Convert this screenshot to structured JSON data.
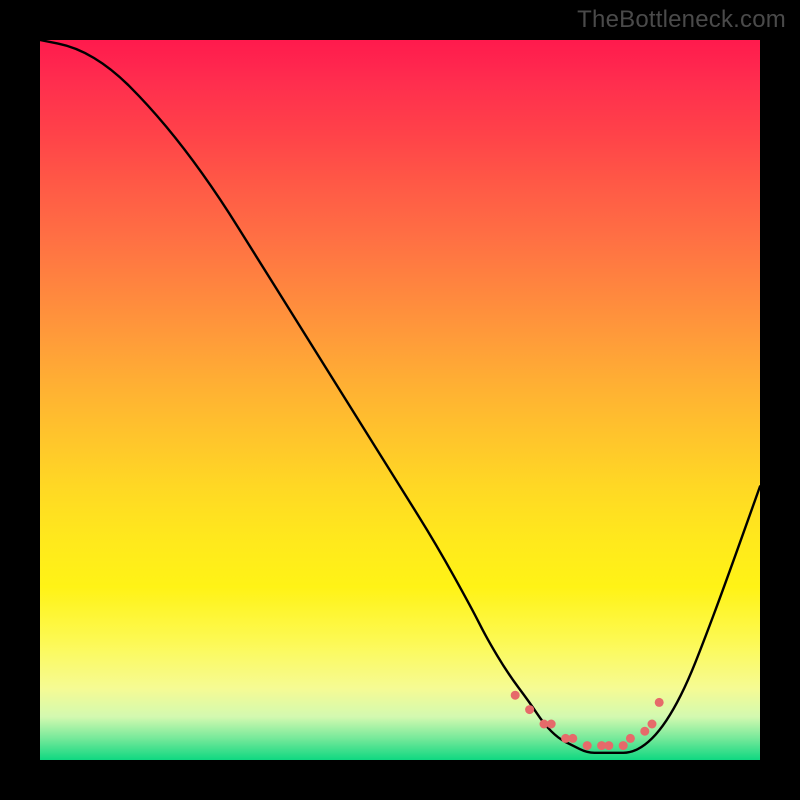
{
  "watermark": "TheBottleneck.com",
  "chart_data": {
    "type": "line",
    "title": "",
    "xlabel": "",
    "ylabel": "",
    "xlim": [
      0,
      100
    ],
    "ylim": [
      0,
      100
    ],
    "series": [
      {
        "name": "bottleneck-curve",
        "x": [
          0,
          5,
          10,
          15,
          20,
          25,
          30,
          35,
          40,
          45,
          50,
          55,
          60,
          62,
          65,
          68,
          70,
          72,
          74,
          76,
          78,
          80,
          82,
          84,
          86,
          88,
          90,
          92,
          95,
          100
        ],
        "values": [
          100,
          99,
          96,
          91,
          85,
          78,
          70,
          62,
          54,
          46,
          38,
          30,
          21,
          17,
          12,
          8,
          5,
          3,
          2,
          1,
          1,
          1,
          1,
          2,
          4,
          7,
          11,
          16,
          24,
          38
        ]
      }
    ],
    "markers": {
      "name": "emphasis-dots",
      "color": "#e66a6a",
      "x": [
        66,
        68,
        70,
        71,
        73,
        74,
        76,
        78,
        79,
        81,
        82,
        84,
        85,
        86
      ],
      "values": [
        9,
        7,
        5,
        5,
        3,
        3,
        2,
        2,
        2,
        2,
        3,
        4,
        5,
        8
      ]
    },
    "gradient_stops": [
      {
        "pos": 0,
        "color": "#ff1a4d"
      },
      {
        "pos": 50,
        "color": "#ffc42c"
      },
      {
        "pos": 80,
        "color": "#fff316"
      },
      {
        "pos": 100,
        "color": "#0fd881"
      }
    ]
  }
}
